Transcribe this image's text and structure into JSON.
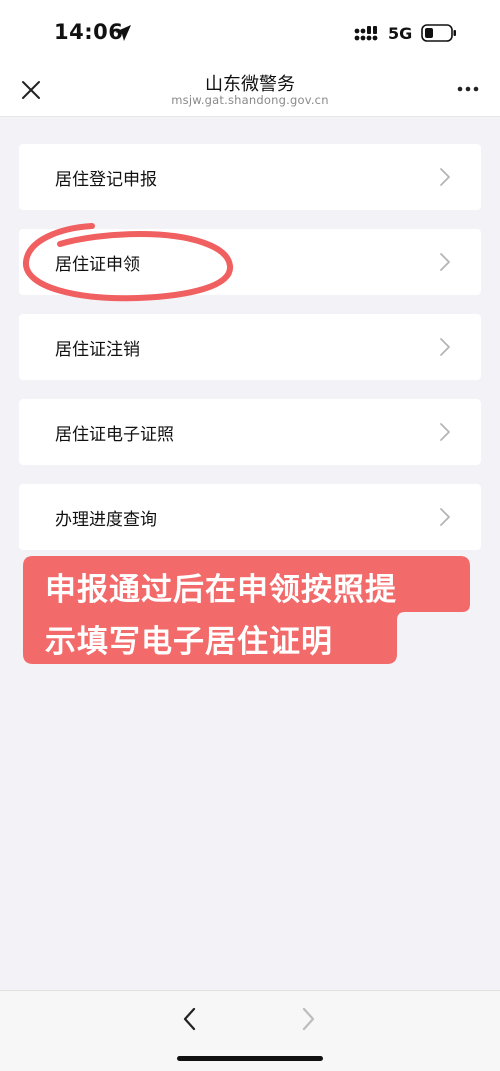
{
  "status_bar": {
    "time": "14:06",
    "network": "5G",
    "icons": [
      "location-arrow-icon",
      "signal-icon",
      "battery-icon"
    ]
  },
  "nav": {
    "title": "山东微警务",
    "url": "msjw.gat.shandong.gov.cn",
    "close_icon": "close-icon",
    "more_icon": "more-icon"
  },
  "menu": {
    "items": [
      {
        "label": "居住登记申报"
      },
      {
        "label": "居住证申领"
      },
      {
        "label": "居住证注销"
      },
      {
        "label": "居住证电子证照"
      },
      {
        "label": "办理进度查询"
      }
    ]
  },
  "callout": {
    "line1": "申报通过后在申领按照提",
    "line2": "示填写电子居住证明"
  },
  "colors": {
    "accent_annotation": "#f06060",
    "callout_bg": "#f26a6a",
    "page_bg": "#f2f2f7"
  }
}
